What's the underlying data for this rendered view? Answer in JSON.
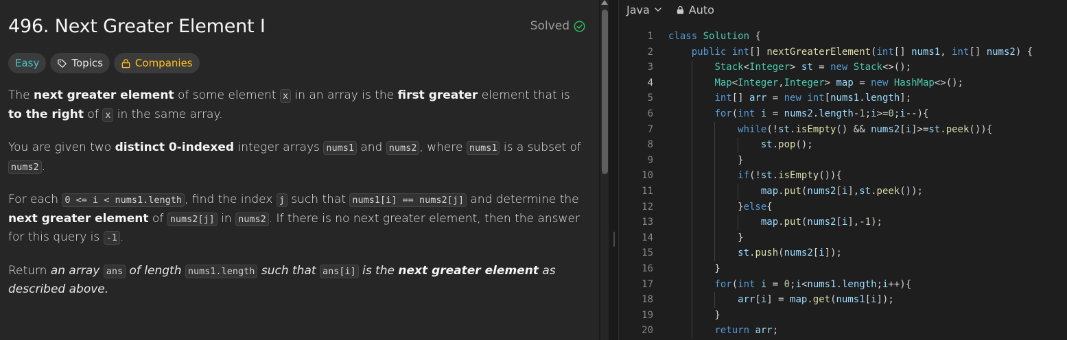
{
  "problem": {
    "title": "496. Next Greater Element I",
    "solved_label": "Solved",
    "tags": {
      "difficulty": "Easy",
      "topics": "Topics",
      "companies": "Companies"
    },
    "description": {
      "p1": {
        "t1": "The ",
        "b1": "next greater element",
        "t2": " of some element ",
        "c1": "x",
        "t3": " in an array is the ",
        "b2": "first greater",
        "t4": " element that is ",
        "b3": "to the right",
        "t5": " of ",
        "c2": "x",
        "t6": " in the same array."
      },
      "p2": {
        "t1": "You are given two ",
        "b1": "distinct 0-indexed",
        "t2": " integer arrays ",
        "c1": "nums1",
        "t3": " and ",
        "c2": "nums2",
        "t4": ", where ",
        "c3": "nums1",
        "t5": " is a subset of ",
        "c4": "nums2",
        "t6": "."
      },
      "p3": {
        "t1": "For each ",
        "c1": "0 <= i < nums1.length",
        "t2": ", find the index ",
        "c2": "j",
        "t3": " such that ",
        "c3": "nums1[i] == nums2[j]",
        "t4": " and determine the ",
        "b1": "next greater element",
        "t5": " of ",
        "c4": "nums2[j]",
        "t6": " in ",
        "c5": "nums2",
        "t7": ". If there is no next greater element, then the answer for this query is ",
        "c6": "-1",
        "t8": "."
      },
      "p4": {
        "t1": "Return ",
        "i1": "an array ",
        "c1": "ans",
        "i2": " of length ",
        "c2": "nums1.length",
        "i3": " such that ",
        "c3": "ans[i]",
        "i4": " is the ",
        "b1": "next greater element",
        "i5": " as described above."
      }
    }
  },
  "editor": {
    "language": "Java",
    "mode": "Auto",
    "active_line": 4,
    "lines": [
      "class Solution {",
      "    public int[] nextGreaterElement(int[] nums1, int[] nums2) {",
      "        Stack<Integer> st = new Stack<>();",
      "        Map<Integer,Integer> map = new HashMap<>();",
      "        int[] arr = new int[nums1.length];",
      "        for(int i = nums2.length-1;i>=0;i--){",
      "            while(!st.isEmpty() && nums2[i]>=st.peek()){",
      "                st.pop();",
      "            }",
      "            if(!st.isEmpty()){",
      "                map.put(nums2[i],st.peek());",
      "            }else{",
      "                map.put(nums2[i],-1);",
      "            }",
      "            st.push(nums2[i]);",
      "        }",
      "        for(int i = 0;i<nums1.length;i++){",
      "            arr[i] = map.get(nums1[i]);",
      "        }",
      "        return arr;"
    ]
  },
  "colors": {
    "easy": "#46c6c2",
    "companies": "#ffc01e",
    "solved_check": "#2cbb5d",
    "keyword": "#569cd6",
    "type": "#4ec9b0",
    "function": "#dcdcaa"
  }
}
